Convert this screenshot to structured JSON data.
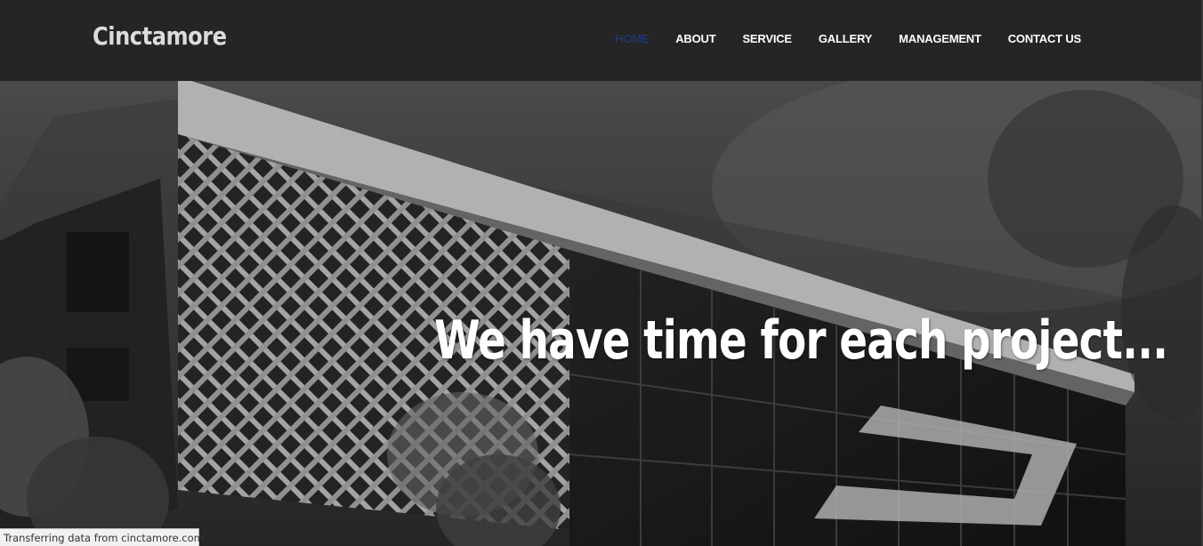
{
  "brand": {
    "name": "Cinctamore"
  },
  "nav": {
    "items": [
      {
        "label": "HOME",
        "active": true
      },
      {
        "label": "ABOUT",
        "active": false
      },
      {
        "label": "SERVICE",
        "active": false
      },
      {
        "label": "GALLERY",
        "active": false
      },
      {
        "label": "MANAGEMENT",
        "active": false
      },
      {
        "label": "CONTACT US",
        "active": false
      }
    ]
  },
  "hero": {
    "headline": "We have time for each project..."
  },
  "status_bar": {
    "text": "Transferring data from cinctamore.com..."
  },
  "colors": {
    "navbar_bg": "#252525",
    "active_link": "#1f3a8a",
    "link": "#ffffff"
  }
}
